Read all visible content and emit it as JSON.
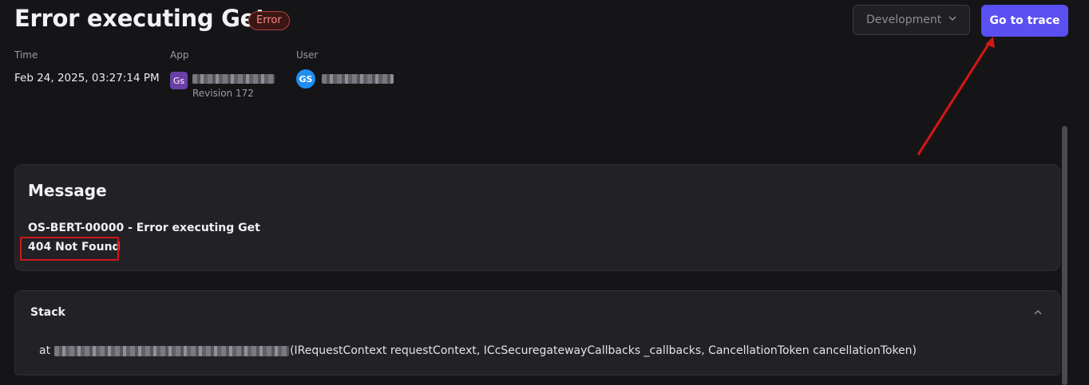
{
  "header": {
    "title": "Error executing Get",
    "badge": "Error",
    "environment": "Development",
    "go_to_trace_label": "Go to trace"
  },
  "meta": {
    "time_label": "Time",
    "time_value": "Feb 24, 2025, 03:27:14 PM",
    "app_label": "App",
    "app_initials": "Gs",
    "app_revision": "Revision 172",
    "user_label": "User",
    "user_initials": "GS"
  },
  "message": {
    "heading": "Message",
    "line1": "OS-BERT-00000 - Error executing Get",
    "line2": "404 Not Found"
  },
  "stack": {
    "heading": "Stack",
    "prefix": "at",
    "signature": "(IRequestContext requestContext, ICcSecuregatewayCallbacks _callbacks, CancellationToken cancellationToken)"
  },
  "colors": {
    "accent": "#5a4ff0",
    "error_badge": "#ff8a80",
    "annotation_red": "#d01818",
    "user_avatar": "#1e8ef0",
    "app_avatar": "#6a3fa8"
  }
}
